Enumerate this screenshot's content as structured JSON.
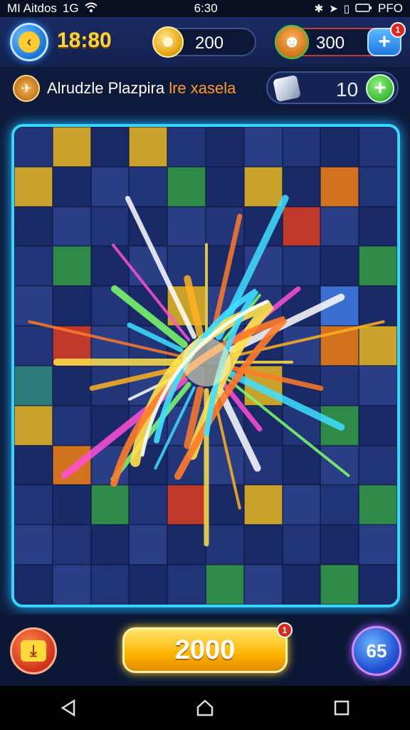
{
  "status_bar": {
    "carrier": "MI Aitdos",
    "network": "1G",
    "time": "6:30",
    "battery_text": "PFO"
  },
  "top_bar": {
    "timer": "18:80",
    "coins": "200",
    "heroes": "300",
    "heroes_badge": "1"
  },
  "level": {
    "title_main": "Alrudzle Plazpira",
    "title_accent": "lre xasela"
  },
  "gems": {
    "value": "10"
  },
  "bottom": {
    "score": "2000",
    "score_badge": "1",
    "moves": "65"
  },
  "colors": {
    "board_glow": "#37d6ff",
    "score_gold": "#ffb400",
    "accent_orange": "#ff9a2a"
  }
}
